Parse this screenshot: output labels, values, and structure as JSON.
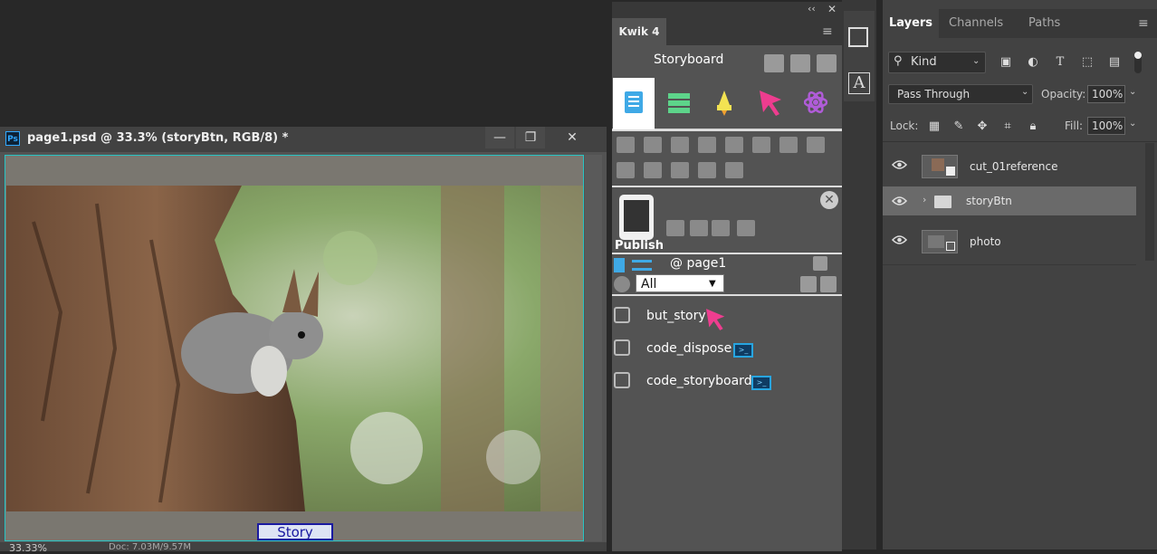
{
  "document": {
    "title": "page1.psd @ 33.3% (storyBtn, RGB/8) *",
    "ps_badge": "Ps",
    "window_buttons": [
      "—",
      "❐",
      "✕"
    ],
    "canvas_button": "Story",
    "zoom": "33.33%",
    "doc_info": "Doc: 7.03M/9.57M"
  },
  "kwik": {
    "top_buttons": [
      "‹‹",
      "✕"
    ],
    "tab": "Kwik 4",
    "menu": "≡",
    "section": "Storyboard",
    "tabs": [
      "pages-icon",
      "list-icon",
      "rocket-icon",
      "pointer-icon",
      "atom-icon"
    ],
    "publish": "Publish",
    "page_label": "@ page1",
    "filter": "All",
    "filter_caret": "▼",
    "items": [
      {
        "label": "but_story",
        "badge": "pointer"
      },
      {
        "label": "code_dispose",
        "badge": "code"
      },
      {
        "label": "code_storyboard",
        "badge": "code"
      }
    ],
    "close": "✕"
  },
  "layers_panel": {
    "tabs": [
      "Layers",
      "Channels",
      "Paths"
    ],
    "menu": "≡",
    "kind": "Kind",
    "blend_mode": "Pass Through",
    "opacity_label": "Opacity:",
    "opacity_value": "100%",
    "lock_label": "Lock:",
    "fill_label": "Fill:",
    "fill_value": "100%",
    "layers": [
      {
        "name": "cut_01reference",
        "type": "smart-object"
      },
      {
        "name": "storyBtn",
        "type": "group"
      },
      {
        "name": "photo",
        "type": "smart-object"
      }
    ]
  },
  "colors": {
    "accent": "#27c4c4",
    "selected_layer": "#6a6a6a",
    "kwik_panel": "#535353"
  }
}
